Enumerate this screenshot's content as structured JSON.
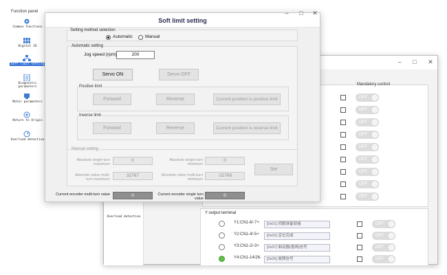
{
  "function_panel": {
    "title": "Function panel",
    "items": [
      {
        "label": "Common functions",
        "icon": "gear-icon"
      },
      {
        "label": "Digital IO",
        "icon": "io-grid-icon"
      },
      {
        "label": "Soft limit setting",
        "icon": "network-icon",
        "active": true
      },
      {
        "label": "Diagnostic parameters",
        "icon": "list-icon"
      },
      {
        "label": "Motor parameters",
        "icon": "motor-icon"
      },
      {
        "label": "Return to Origin",
        "icon": "target-icon"
      },
      {
        "label": "Overload detection",
        "icon": "gauge-icon"
      }
    ]
  },
  "window_controls": {
    "minimize": "–",
    "maximize": "□",
    "close": "✕"
  },
  "main": {
    "title": "Soft limit setting",
    "method": {
      "title": "Setting method selection",
      "options": [
        "Automatic",
        "Manual"
      ],
      "selected": "Automatic"
    },
    "automatic": {
      "title": "Automatic setting",
      "jog_label": "Jog speed (rpm)",
      "jog_value": "200",
      "servo_on": "Servo ON",
      "servo_off": "Servo OFF",
      "positive": {
        "title": "Positive limit",
        "forward": "Forward",
        "reverse": "Reverse",
        "current": "Current position is positive limit"
      },
      "inverse": {
        "title": "Inverse limit",
        "forward": "Forward",
        "reverse": "Reverse",
        "current": "Current position is reverse limit"
      }
    },
    "manual": {
      "title": "Manual setting",
      "abs_max_label": "Absolute single-turn maximum",
      "abs_max_value": "0",
      "abs_min_label": "Absolute single-turn minimum",
      "abs_min_value": "0",
      "multi_max_label": "Absolute value multi-turn maximum",
      "multi_max_value": "32767",
      "multi_min_label": "Absolute value multi-turn minimum",
      "multi_min_value": "-32768",
      "set": "Set"
    },
    "encoder": {
      "multi_label": "Current encoder multi-turn value",
      "multi_value": "0",
      "single_label": "Current encoder single turn value",
      "single_value": "0"
    }
  },
  "back": {
    "mandatory_header": "Mandatory control",
    "toggle_text": "OFF",
    "left_label": "Overload detection",
    "y_title": "Y output terminal",
    "y_rows": [
      {
        "label": "Y1:CN1-6/-7+",
        "value": "[0x01] 伺服准备就绪",
        "on": false
      },
      {
        "label": "Y2:CN1-4/-5+",
        "value": "[0x02] 定位完成",
        "on": false
      },
      {
        "label": "Y3:CN1-2/-3+",
        "value": "[0x07] 制动器(抱闸)信号",
        "on": false
      },
      {
        "label": "Y4:CN1-14/26-",
        "value": "[0x05] 故障信号",
        "on": true
      }
    ]
  }
}
